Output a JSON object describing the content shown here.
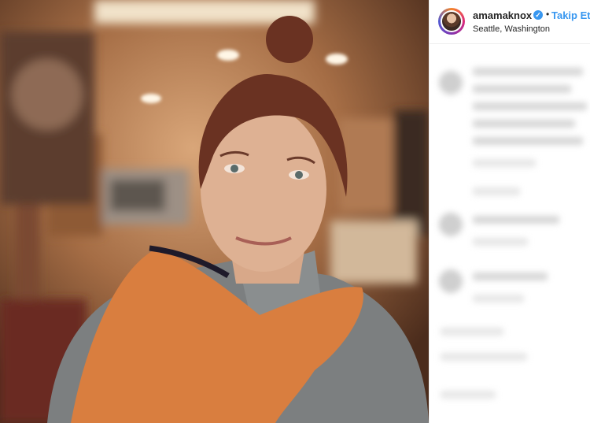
{
  "post": {
    "username": "amamaknox",
    "verified_glyph": "✓",
    "separator": "•",
    "follow_label": "Takip Et",
    "location": "Seattle, Washington"
  },
  "icons": {
    "verified": "verified-badge-icon"
  },
  "colors": {
    "accent": "#3897f0",
    "text": "#262626",
    "border": "#efefef"
  }
}
